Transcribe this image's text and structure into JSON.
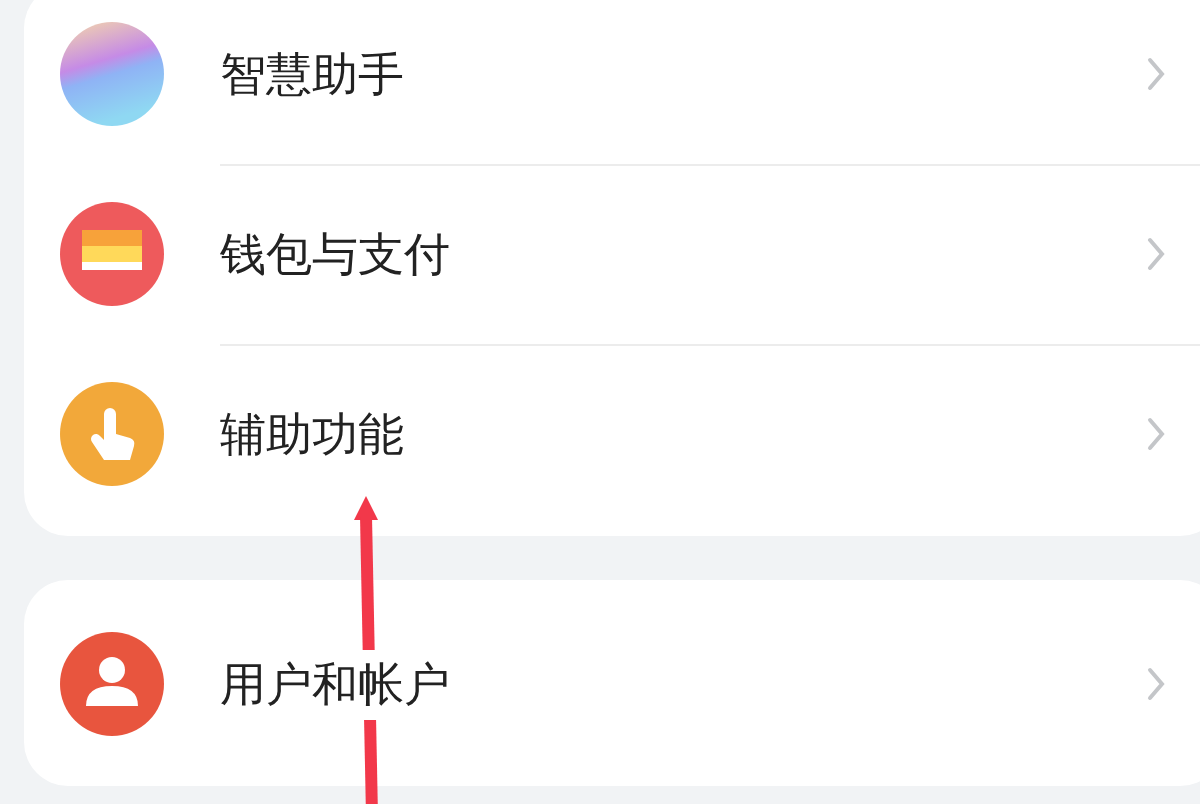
{
  "sections": [
    {
      "items": [
        {
          "label": "智慧助手",
          "kind": "assistant"
        },
        {
          "label": "钱包与支付",
          "kind": "wallet"
        },
        {
          "label": "辅助功能",
          "kind": "accessibility"
        }
      ]
    },
    {
      "items": [
        {
          "label": "用户和帐户",
          "kind": "user"
        }
      ]
    }
  ]
}
